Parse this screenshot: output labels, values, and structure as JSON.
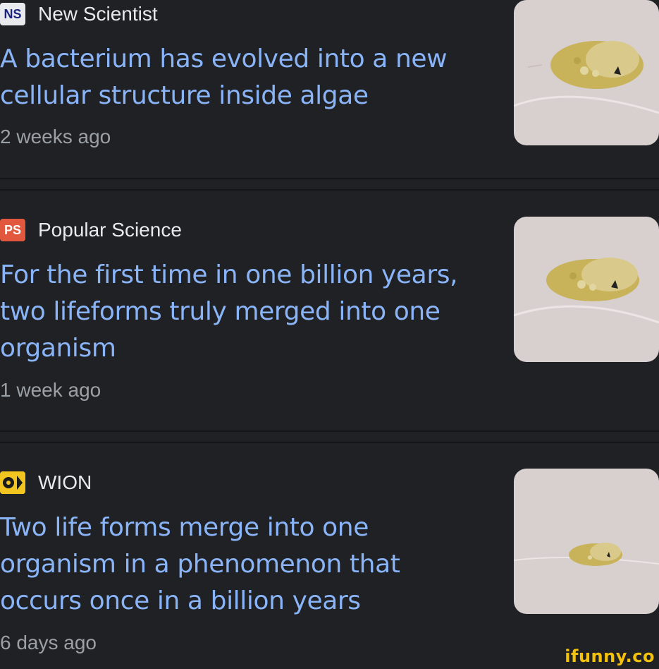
{
  "articles": [
    {
      "source": "New Scientist",
      "source_icon": "new-scientist-logo-icon",
      "icon_text": "NS",
      "headline_lines": [
        "A bacterium has evolved into a new",
        "cellular structure inside algae"
      ],
      "time": "2 weeks ago"
    },
    {
      "source": "Popular Science",
      "source_icon": "popular-science-logo-icon",
      "icon_text": "PS",
      "headline_lines": [
        "For the first time in one billion years,",
        "two lifeforms truly merged into one",
        "organism"
      ],
      "time": "1 week ago"
    },
    {
      "source": "WION",
      "source_icon": "wion-logo-icon",
      "icon_text": "",
      "headline_lines": [
        "Two life forms merge into one",
        "organism in a phenomenon that",
        "occurs once in a billion years"
      ],
      "time": "6 days ago"
    }
  ],
  "watermark": "ifunny.co",
  "colors": {
    "background": "#202124",
    "headline": "#8ab4f8",
    "source_text": "#e8eaed",
    "time_text": "#9aa0a6",
    "watermark": "#f4c20d"
  }
}
